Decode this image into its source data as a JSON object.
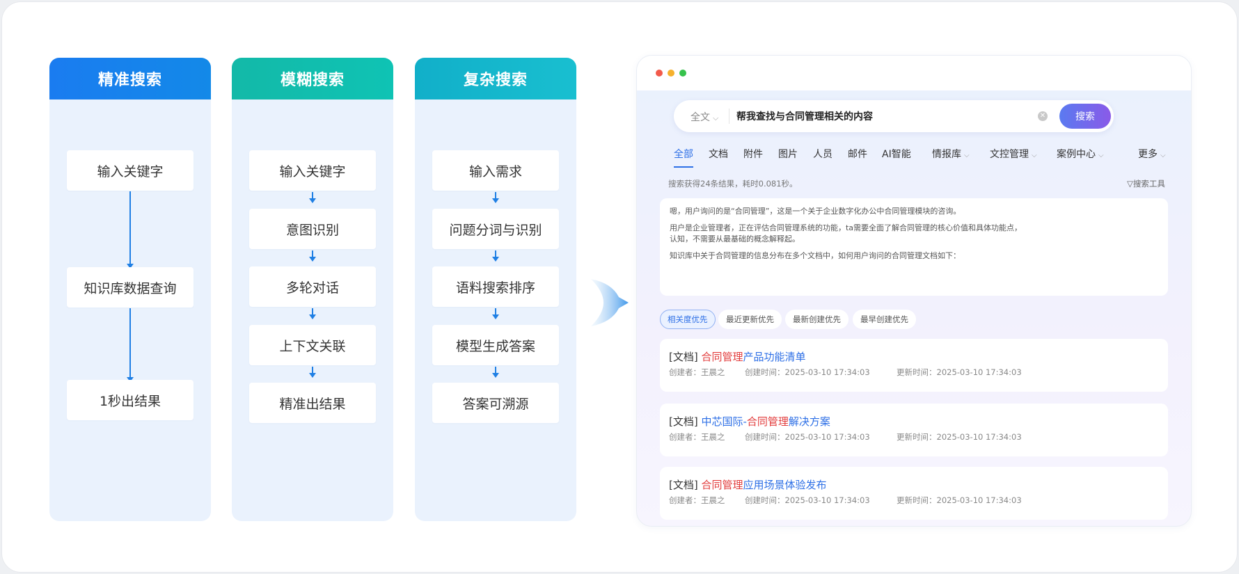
{
  "columns": [
    {
      "title": "精准搜索",
      "steps": [
        "输入关键字",
        "知识库数据查询",
        "1秒出结果"
      ]
    },
    {
      "title": "模糊搜索",
      "steps": [
        "输入关键字",
        "意图识别",
        "多轮对话",
        "上下文关联",
        "精准出结果"
      ]
    },
    {
      "title": "复杂搜索",
      "steps": [
        "输入需求",
        "问题分词与识别",
        "语料搜索排序",
        "模型生成答案",
        "答案可溯源"
      ]
    }
  ],
  "search": {
    "scope": "全文",
    "query": "帮我查找与合同管理相关的内容",
    "button": "搜索"
  },
  "tabs": [
    "全部",
    "文档",
    "附件",
    "图片",
    "人员",
    "邮件",
    "AI智能",
    "情报库",
    "文控管理",
    "案例中心",
    "更多"
  ],
  "stats": "搜索获得24条结果，耗时0.081秒。",
  "tools": "搜索工具",
  "ai_answer": {
    "p1": "嗯，用户询问的是“合同管理”，这是一个关于企业数字化办公中合同管理模块的咨询。",
    "p2a": "用户是企业管理者，正在评估合同管理系统的功能，ta需要全面了解合同管理的核心价值和具体功能点，",
    "p2b": "认知，不需要从最基础的概念解释起。",
    "p3": "知识库中关于合同管理的信息分布在多个文档中，如何用户询问的合同管理文档如下："
  },
  "sort_chips": [
    "相关度优先",
    "最近更新优先",
    "最新创建优先",
    "最早创建优先"
  ],
  "results": [
    {
      "tag": "[文档] ",
      "prefix": "",
      "highlight": "合同管理",
      "suffix": "产品功能清单",
      "creator": "创建者：王晨之",
      "created": "创建时间：2025-03-10 17:34:03",
      "updated": "更新时间：2025-03-10 17:34:03"
    },
    {
      "tag": "[文档] ",
      "prefix": "中芯国际-",
      "highlight": "合同管理",
      "suffix": "解决方案",
      "creator": "创建者：王晨之",
      "created": "创建时间：2025-03-10 17:34:03",
      "updated": "更新时间：2025-03-10 17:34:03"
    },
    {
      "tag": "[文档] ",
      "prefix": "",
      "highlight": "合同管理",
      "suffix": "应用场景体验发布",
      "creator": "创建者：王晨之",
      "created": "创建时间：2025-03-10 17:34:03",
      "updated": "更新时间：2025-03-10 17:34:03"
    }
  ],
  "colors": {
    "accent": "#2d6fe6",
    "highlight": "#e23c3c",
    "col1_head": "#1a7cf0",
    "col2_head": "#13b9a8",
    "col3_head": "#11afc9"
  }
}
